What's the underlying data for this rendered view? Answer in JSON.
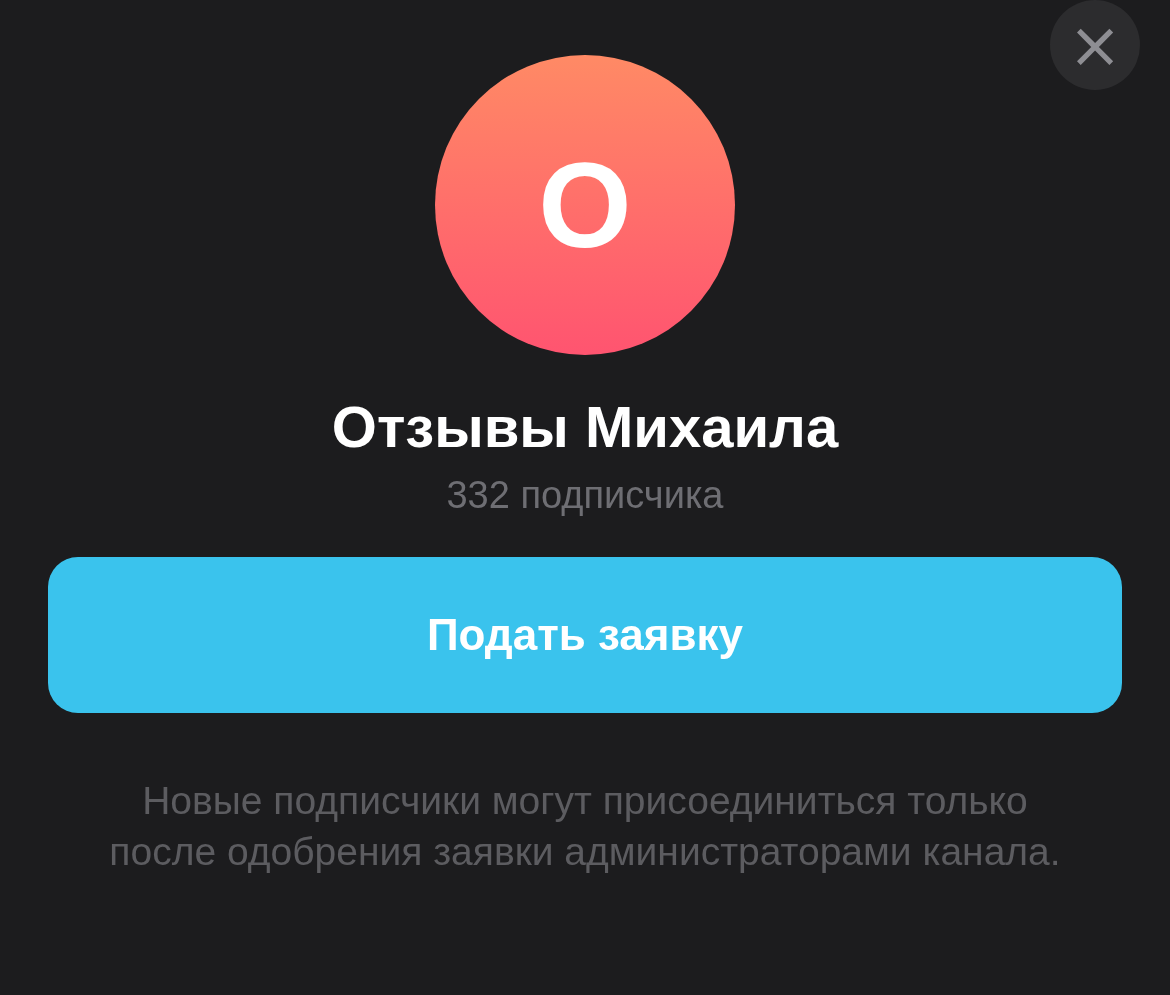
{
  "close_button": {
    "label": "×"
  },
  "avatar": {
    "letter": "О"
  },
  "channel": {
    "title": "Отзывы Михаила",
    "subscribers": "332 подписчика"
  },
  "primary_button": {
    "label": "Подать заявку"
  },
  "note": "Новые подписчики могут присоединиться только после одобрения заявки администраторами канала."
}
